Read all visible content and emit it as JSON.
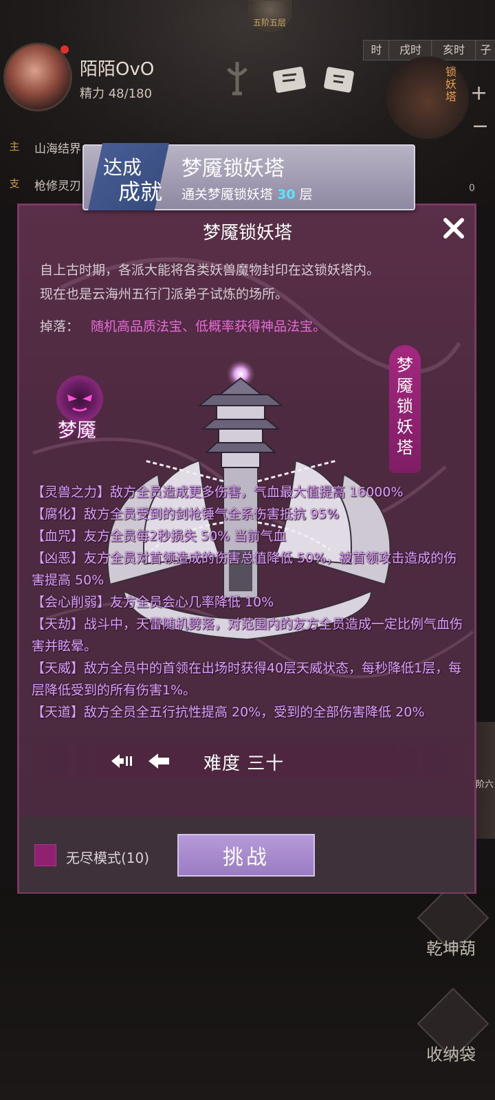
{
  "hud": {
    "top_badge": "五阶五层",
    "player_name": "陌陌OvO",
    "energy": "精力 48/180",
    "time_tabs": {
      "prev": "时",
      "xu": "戌时",
      "hai": "亥时",
      "next": "子"
    },
    "tower_shortcut_label": "锁妖塔",
    "quests": [
      {
        "tag": "主",
        "text": "山海结界"
      },
      {
        "tag": "支",
        "text": "枪修灵刃"
      }
    ],
    "right_counter": "0",
    "right_rail_text": "阶六",
    "bottom_buttons": [
      {
        "label": "乾坤葫",
        "icon": "gourd-icon"
      },
      {
        "label": "收纳袋",
        "icon": "bag-icon"
      }
    ]
  },
  "achievement": {
    "badge_line1": "达成",
    "badge_line2": "成就",
    "title": "梦魇锁妖塔",
    "desc_prefix": "通关梦魇锁妖塔",
    "desc_number": "30",
    "desc_suffix": "层"
  },
  "dialog": {
    "title": "梦魇锁妖塔",
    "intro": [
      "自上古时期，各派大能将各类妖兽魔物封印在这锁妖塔内。",
      "现在也是云海州五行门派弟子试炼的场所。"
    ],
    "drop_label": "掉落：",
    "drop_text": "随机高品质法宝、低概率获得神品法宝。",
    "demon_label": "梦魇",
    "tower_banner": "梦魇锁妖塔",
    "effects": [
      "【灵兽之力】敌方全员造成更多伤害，气血最大值提高 16000%",
      "【腐化】敌方全员受到的剑枪锤气全系伤害抵抗 95%",
      "【血咒】友方全员每2秒损失 50% 当前气血",
      "【凶恶】友方全员对首领造成的伤害总值降低 50%，被首领攻击造成的伤害提高 50%",
      "【会心削弱】友方全员会心几率降低 10%",
      "【天劫】战斗中，天雷随机劈落，对范围内的友方全员造成一定比例气血伤害并眩晕。",
      "【天威】敌方全员中的首领在出场时获得40层天威状态，每秒降低1层，每层降低受到的所有伤害1%。",
      "【天道】敌方全员全五行抗性提高 20%，受到的全部伤害降低 20%"
    ],
    "difficulty": "难度 三十",
    "endless_mode": "无尽模式(10)",
    "challenge_button": "挑战"
  },
  "colors": {
    "dialog_bg": "#4e2a40",
    "effect_text": "#d6a0f8",
    "drop_text": "#e56cd8",
    "achievement_number": "#59e4ff",
    "challenge_button": "#a98acf",
    "checkbox": "#8f2170"
  }
}
